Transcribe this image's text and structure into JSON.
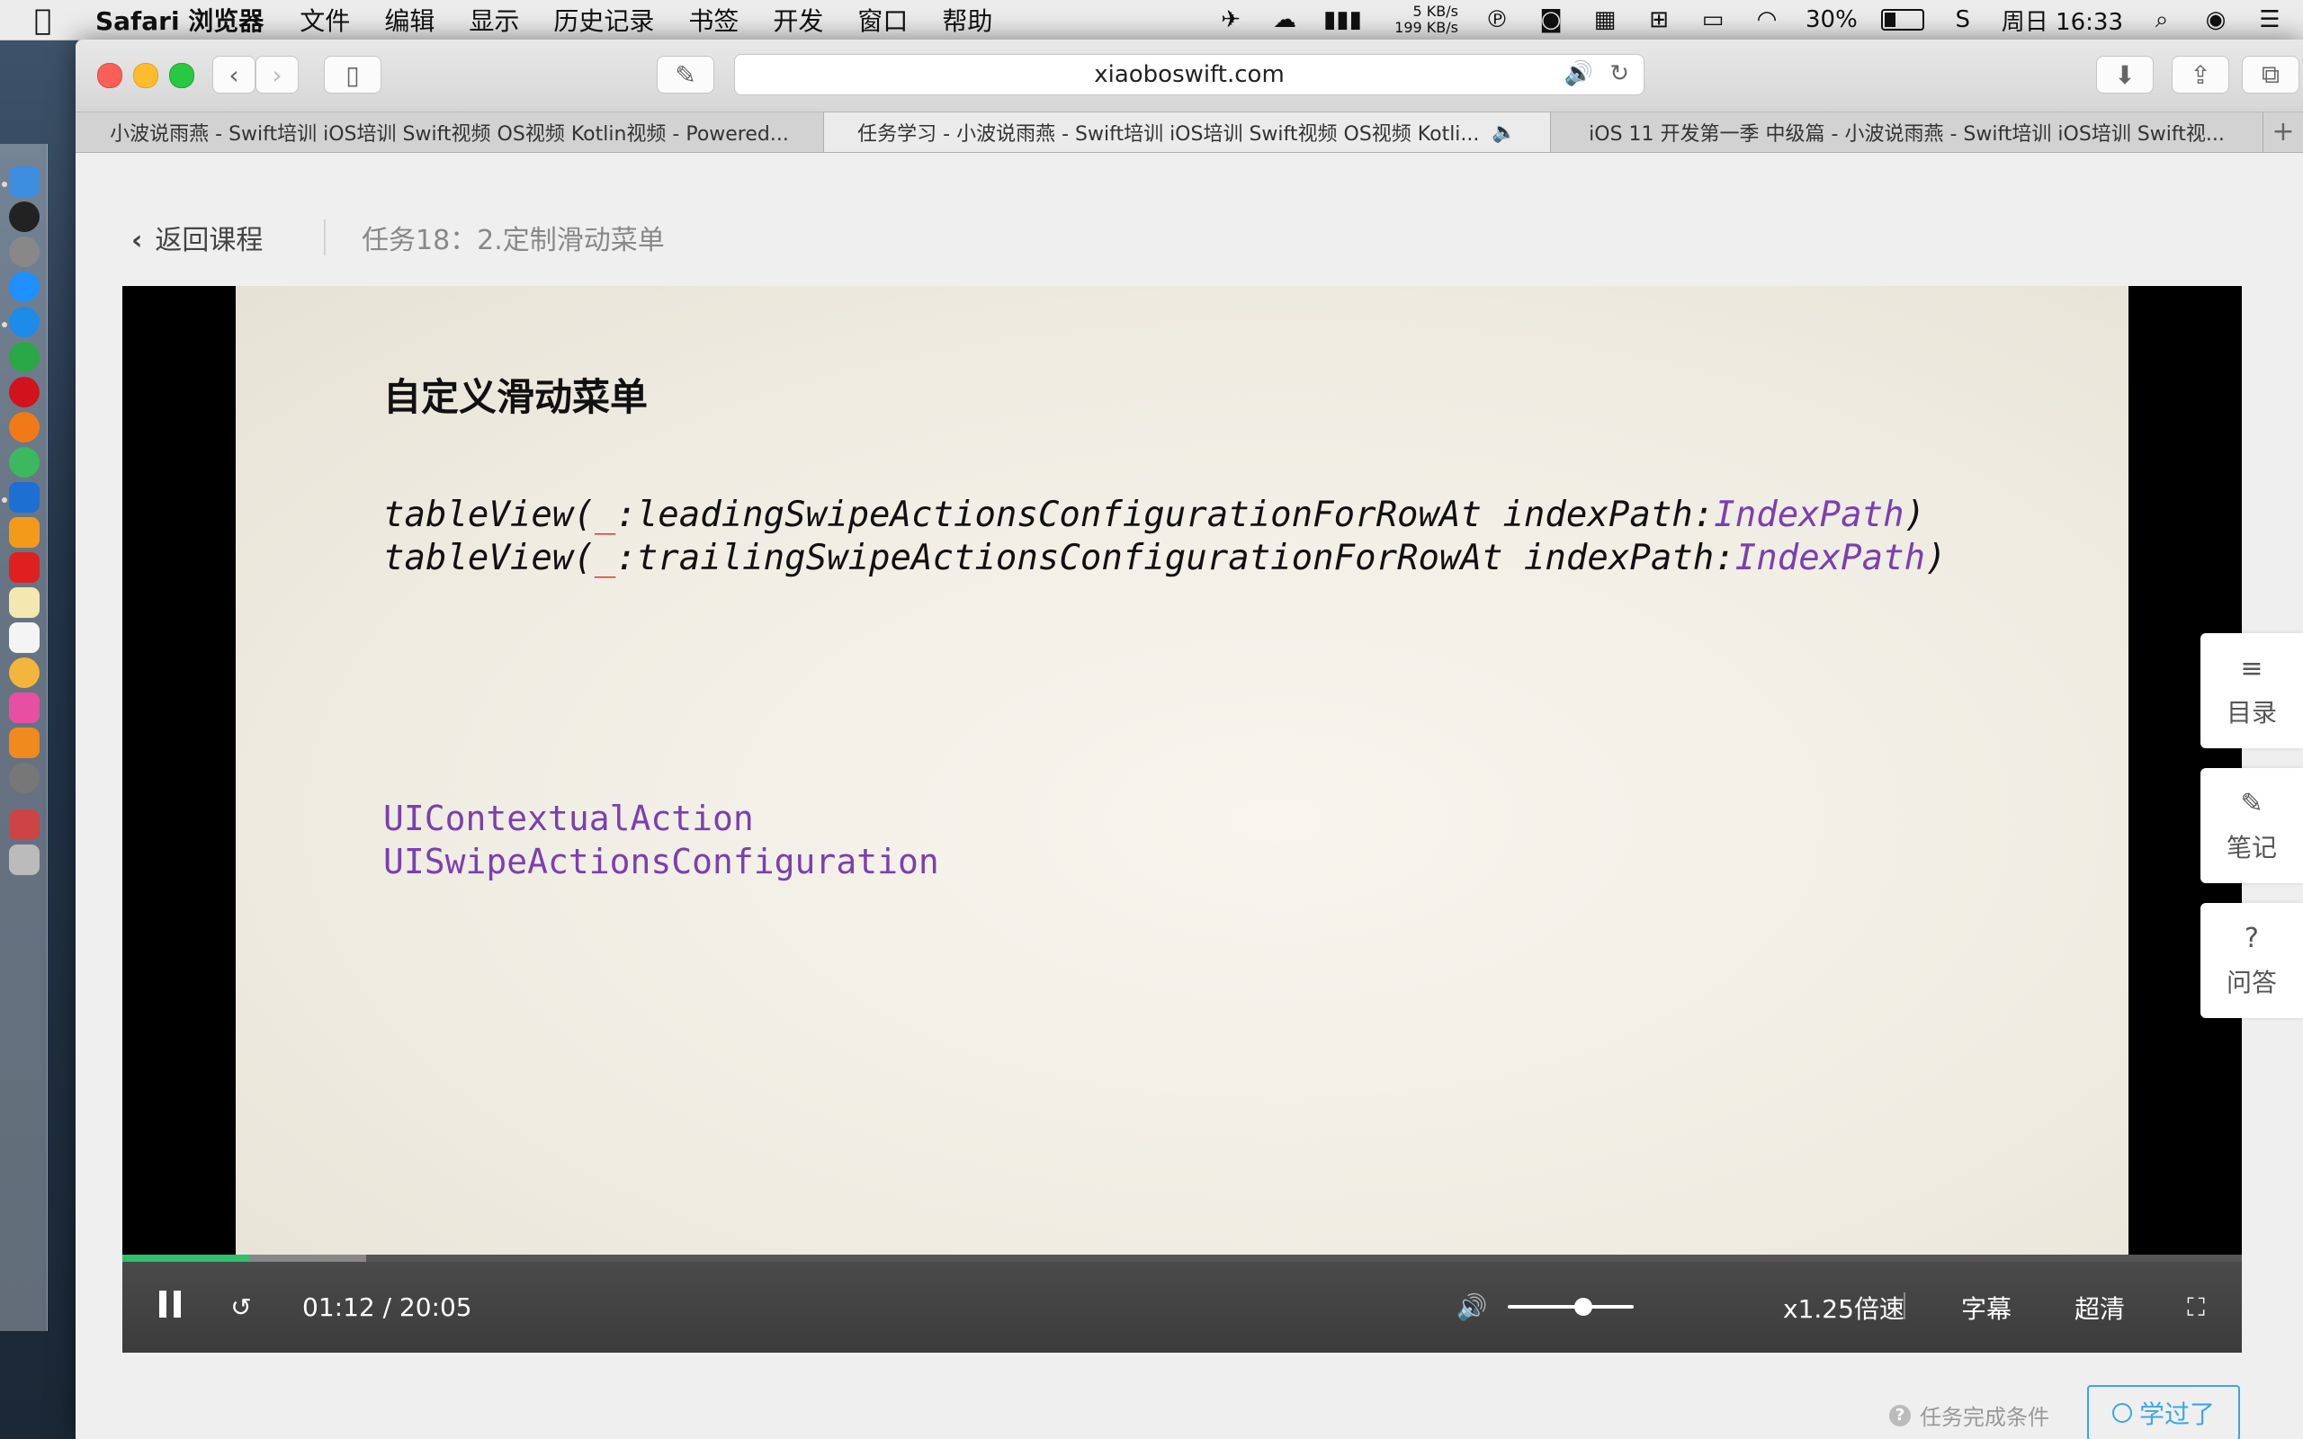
{
  "menubar": {
    "app_name": "Safari 浏览器",
    "items": [
      "文件",
      "编辑",
      "显示",
      "历史记录",
      "书签",
      "开发",
      "窗口",
      "帮助"
    ],
    "net_up": "5 KB/s",
    "net_down": "199 KB/s",
    "battery": "30%",
    "battery_level": 0.3,
    "clock": "周日 16:33"
  },
  "browser": {
    "url": "xiaoboswift.com",
    "tabs": [
      {
        "title": "小波说雨燕 - Swift培训 iOS培训 Swift视频 OS视频 Kotlin视频 - Powered..."
      },
      {
        "title": "任务学习 - 小波说雨燕 - Swift培训 iOS培训 Swift视频 OS视频 Kotli..."
      },
      {
        "title": "iOS 11 开发第一季 中级篇 - 小波说雨燕 - Swift培训 iOS培训 Swift视..."
      }
    ],
    "new_tab": "+"
  },
  "page": {
    "back_label": "返回课程",
    "task_title": "任务18：2.定制滑动菜单",
    "slide": {
      "title": "自定义滑动菜单",
      "line1_a": "tableView(",
      "line1_b": "_",
      "line1_c": ":leadingSwipeActionsConfigurationForRowAt indexPath:",
      "line1_d": "IndexPath",
      "line1_e": ")",
      "line2_a": "tableView(",
      "line2_b": "_",
      "line2_c": ":trailingSwipeActionsConfigurationForRowAt indexPath:",
      "line2_d": "IndexPath",
      "line2_e": ")",
      "class1": "UIContextualAction",
      "class2": "UISwipeActionsConfiguration"
    },
    "player": {
      "time": "01:12 / 20:05",
      "speed": "x1.25倍速",
      "subtitles": "字幕",
      "quality": "超清",
      "progress": 0.06,
      "buffered": 0.115,
      "volume": 0.6
    },
    "side": {
      "toc": "目录",
      "notes": "笔记",
      "qa": "问答"
    },
    "bottom": {
      "condition": "任务完成条件",
      "learned": "学过了"
    }
  }
}
